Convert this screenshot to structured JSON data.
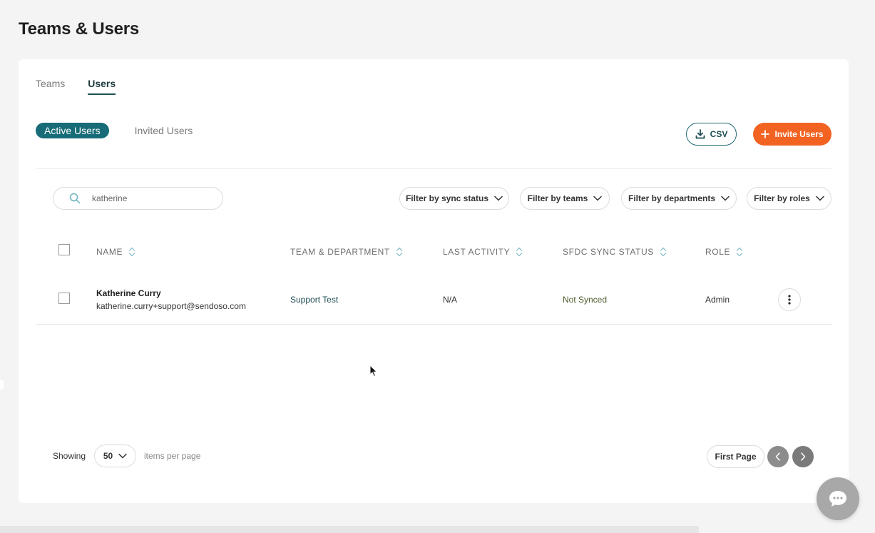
{
  "page": {
    "title": "Teams & Users"
  },
  "tabs": [
    {
      "label": "Teams",
      "active": false
    },
    {
      "label": "Users",
      "active": true
    }
  ],
  "subtabs": [
    {
      "label": "Active Users",
      "active": true
    },
    {
      "label": "Invited Users",
      "active": false
    }
  ],
  "actions": {
    "csv_label": "CSV",
    "invite_label": "Invite Users",
    "accent_color": "#f26322",
    "primary_color": "#176c78"
  },
  "search": {
    "value": "katherine",
    "icon": "search-icon"
  },
  "filters": [
    "Filter by sync status",
    "Filter by teams",
    "Filter by departments",
    "Filter by roles"
  ],
  "table": {
    "columns": [
      "NAME",
      "TEAM & DEPARTMENT",
      "LAST ACTIVITY",
      "SFDC SYNC STATUS",
      "ROLE"
    ],
    "rows": [
      {
        "name": "Katherine Curry",
        "email": "katherine.curry+support@sendoso.com",
        "team": "Support Test",
        "last_activity": "N/A",
        "sync_status": "Not Synced",
        "role": "Admin"
      }
    ]
  },
  "pagination": {
    "showing_label": "Showing",
    "per_page_value": "50",
    "items_label": "items per page",
    "first_page_label": "First Page"
  }
}
